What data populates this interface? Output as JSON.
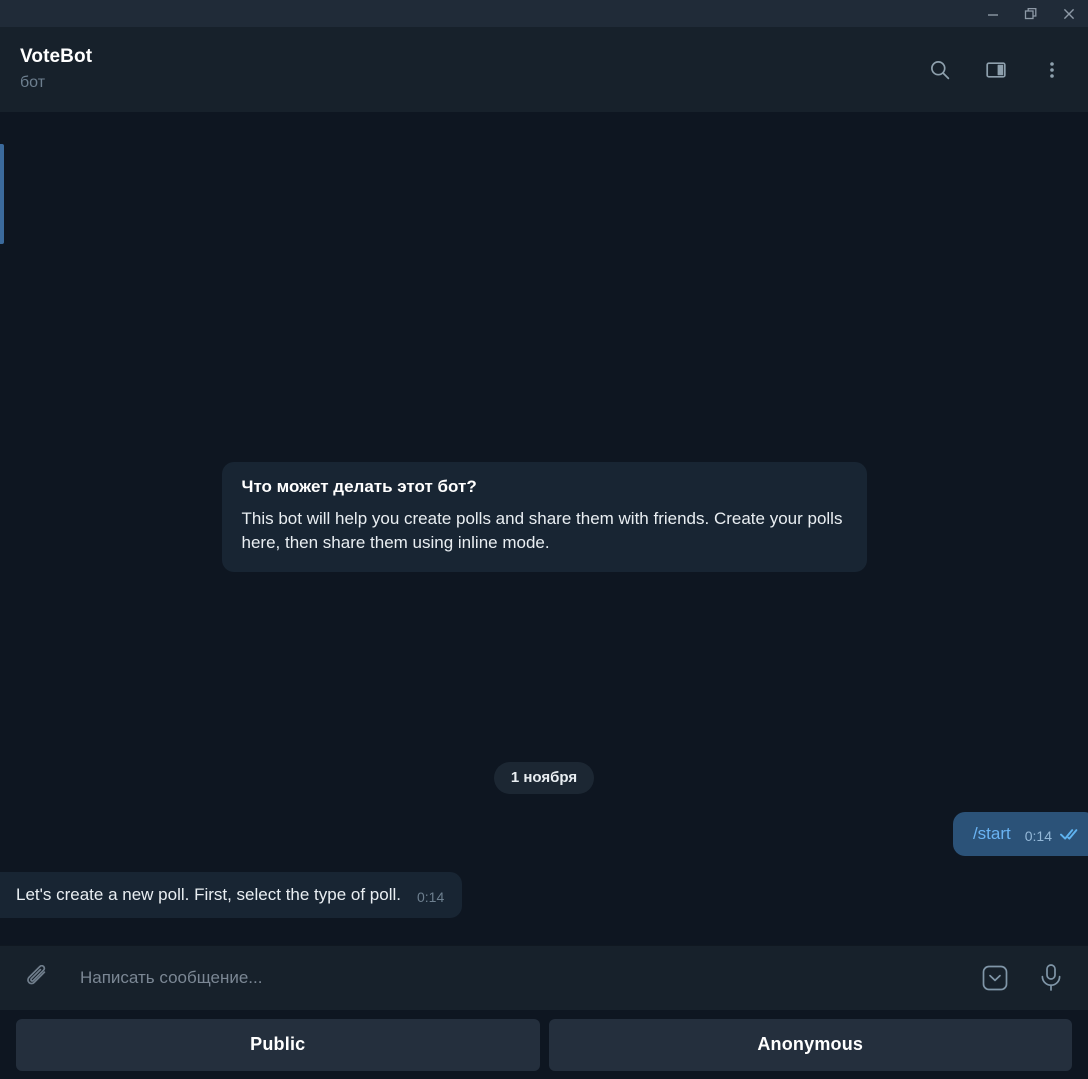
{
  "titlebar": {
    "minimize_label": "Minimize",
    "restore_label": "Restore",
    "close_label": "Close"
  },
  "header": {
    "peer_name": "VoteBot",
    "peer_status": "бот",
    "search_label": "Search",
    "panel_label": "Toggle info panel",
    "menu_label": "More options"
  },
  "chat": {
    "bot_info": {
      "title": "Что может делать этот бот?",
      "text": "This bot will help you create polls and share them with friends. Create your polls here, then share them using inline mode."
    },
    "date_separator": "1 ноября",
    "outgoing": {
      "text": "/start",
      "time": "0:14",
      "status": "read"
    },
    "incoming": {
      "text": "Let's create a new poll. First, select the type of poll.",
      "time": "0:14"
    }
  },
  "composer": {
    "attach_label": "Attach file",
    "placeholder": "Написать сообщение...",
    "value": "",
    "keyboard_toggle_label": "Hide bot keyboard",
    "voice_label": "Record voice message"
  },
  "bot_keyboard": {
    "buttons": [
      {
        "label": "Public"
      },
      {
        "label": "Anonymous"
      }
    ]
  },
  "colors": {
    "background": "#0e1621",
    "header": "#17212b",
    "titlebar": "#202b38",
    "bubble_in": "#182533",
    "bubble_out": "#2b5278",
    "accent": "#6ab3f3",
    "keyboard_button": "#242f3d",
    "left_strip": "#3b6a9c"
  }
}
